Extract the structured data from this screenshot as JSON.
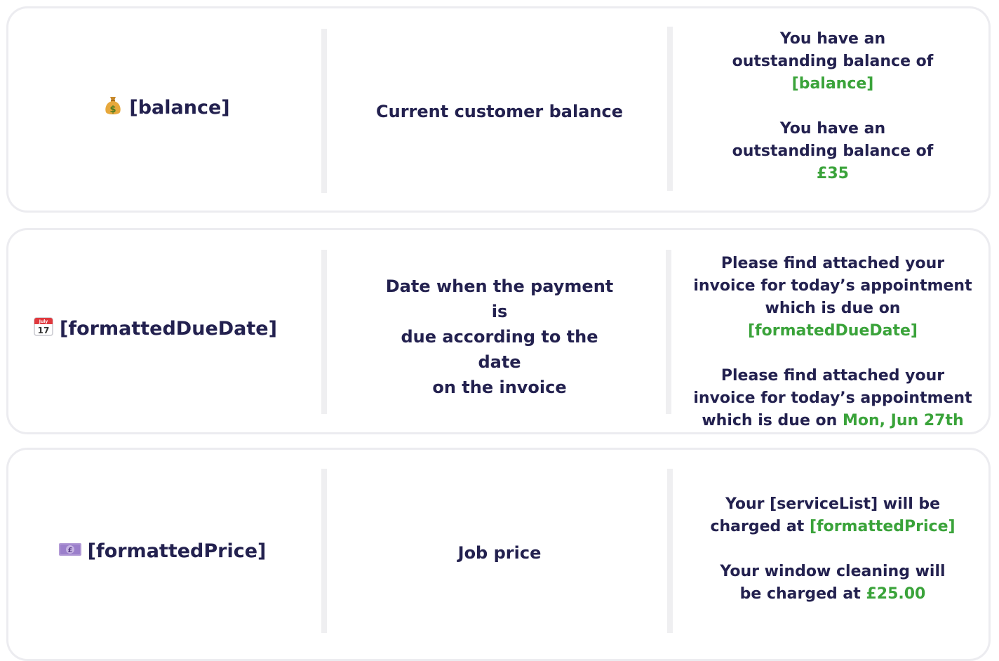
{
  "rows": [
    {
      "icon": "money-bag-icon",
      "variable": "[balance]",
      "description": "Current customer balance",
      "template_prefix": "You have an outstanding balance of",
      "template_var": "[balance]",
      "example_prefix": "You have an outstanding balance of",
      "example_value": "£35"
    },
    {
      "icon": "calendar-icon",
      "calendar_month": "July",
      "calendar_day": "17",
      "variable": "[formattedDueDate]",
      "description_lines": [
        "Date when the payment",
        "is",
        "due according to the",
        "date",
        "on the invoice"
      ],
      "template_prefix": "Please find attached your invoice for today’s appointment which is due on",
      "template_var": "[formatedDueDate]",
      "example_prefix": "Please find attached your invoice for today’s appointment which is due on",
      "example_value": "Mon, Jun 27th"
    },
    {
      "icon": "pound-banknote-icon",
      "banknote_symbol": "£",
      "variable": "[formattedPrice]",
      "description": "Job price",
      "template_prefix": "Your [serviceList] will be charged at",
      "template_var": "[formattedPrice]",
      "example_prefix": "Your window cleaning will be charged at",
      "example_value": "£25.00"
    }
  ],
  "colors": {
    "text": "#23214f",
    "highlight": "#3aa33a",
    "border": "#ececf0",
    "divider": "#efeff1"
  }
}
